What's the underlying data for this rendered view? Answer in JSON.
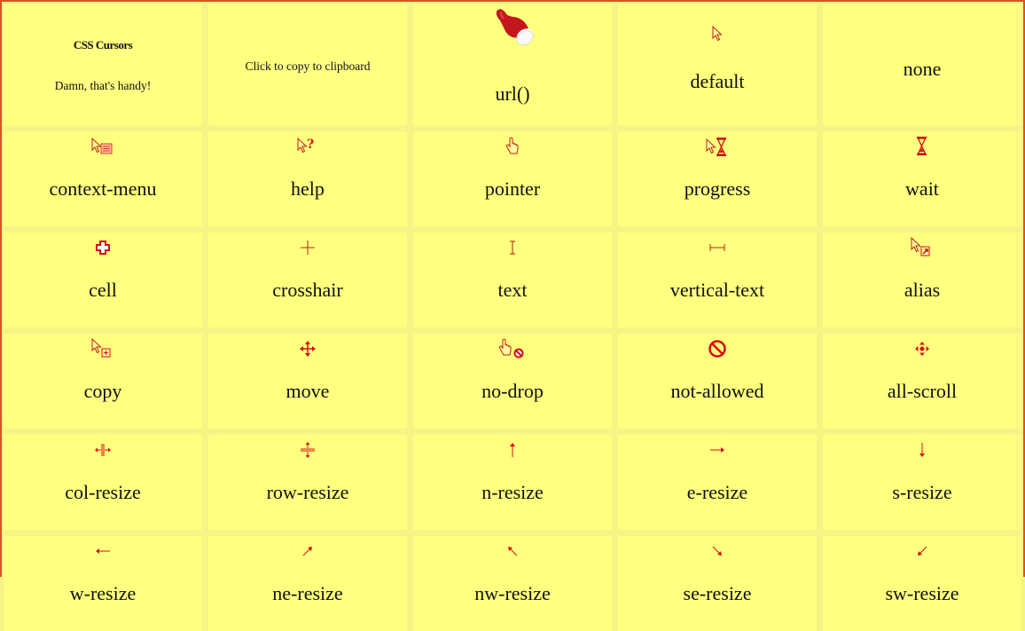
{
  "info": {
    "title": "CSS Cursors",
    "subtitle": "Damn, that's handy!"
  },
  "copy_hint": "Click to copy to clipboard",
  "colors": {
    "background_cell": "#ffff80",
    "gap": "#f5f585",
    "frame": "#d9531e",
    "icon": "#d41010",
    "text": "#111111"
  },
  "cursors": [
    {
      "name": "url()",
      "icon": "santa-hat-hand-icon"
    },
    {
      "name": "default",
      "icon": "arrow-pointer-icon"
    },
    {
      "name": "none",
      "icon": ""
    },
    {
      "name": "context-menu",
      "icon": "context-menu-icon"
    },
    {
      "name": "help",
      "icon": "help-icon"
    },
    {
      "name": "pointer",
      "icon": "pointing-hand-icon"
    },
    {
      "name": "progress",
      "icon": "progress-icon"
    },
    {
      "name": "wait",
      "icon": "hourglass-icon"
    },
    {
      "name": "cell",
      "icon": "cell-plus-icon"
    },
    {
      "name": "crosshair",
      "icon": "crosshair-icon"
    },
    {
      "name": "text",
      "icon": "i-beam-icon"
    },
    {
      "name": "vertical-text",
      "icon": "vertical-text-icon"
    },
    {
      "name": "alias",
      "icon": "alias-icon"
    },
    {
      "name": "copy",
      "icon": "copy-icon"
    },
    {
      "name": "move",
      "icon": "move-icon"
    },
    {
      "name": "no-drop",
      "icon": "no-drop-icon"
    },
    {
      "name": "not-allowed",
      "icon": "not-allowed-icon"
    },
    {
      "name": "all-scroll",
      "icon": "all-scroll-icon"
    },
    {
      "name": "col-resize",
      "icon": "col-resize-icon"
    },
    {
      "name": "row-resize",
      "icon": "row-resize-icon"
    },
    {
      "name": "n-resize",
      "icon": "arrow-up-icon"
    },
    {
      "name": "e-resize",
      "icon": "arrow-right-icon"
    },
    {
      "name": "s-resize",
      "icon": "arrow-down-icon"
    },
    {
      "name": "w-resize",
      "icon": "arrow-left-icon"
    },
    {
      "name": "ne-resize",
      "icon": "arrow-up-right-icon"
    },
    {
      "name": "nw-resize",
      "icon": "arrow-up-left-icon"
    },
    {
      "name": "se-resize",
      "icon": "arrow-down-right-icon"
    },
    {
      "name": "sw-resize",
      "icon": "arrow-down-left-icon"
    }
  ]
}
